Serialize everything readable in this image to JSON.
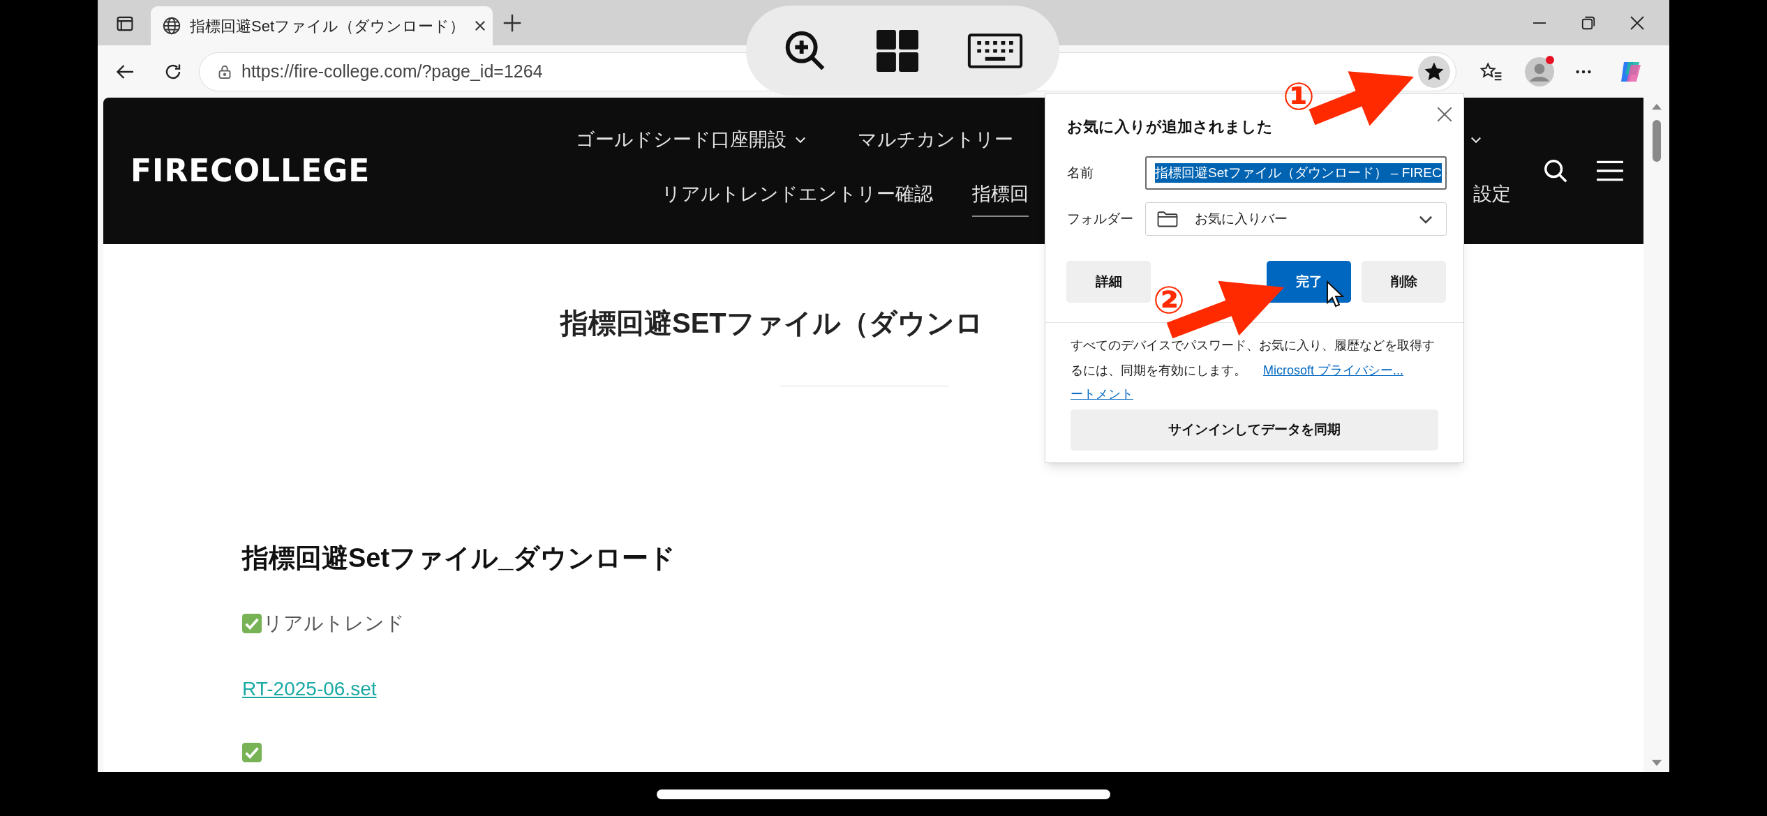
{
  "browser": {
    "tab": {
      "title": "指標回避Setファイル（ダウンロード）",
      "selected": true
    },
    "address": "https://fire-college.com/?page_id=1264",
    "favorite_added": true,
    "profile_notification": true
  },
  "site": {
    "logo": "FIRECOLLEGE",
    "nav_row_1": [
      {
        "label": "ゴールドシード口座開設",
        "dropdown": true
      },
      {
        "label": "マルチカントリー",
        "dropdown": false
      }
    ],
    "nav_row_2": [
      {
        "label": "リアルトレンドエントリー確認",
        "selected": false
      },
      {
        "label": "指標回",
        "selected": true
      }
    ],
    "nav_right": {
      "label": "設定",
      "selected": false
    }
  },
  "page": {
    "title": "指標回避SETファイル（ダウンロ",
    "heading": "指標回避Setファイル_ダウンロード",
    "items": [
      {
        "kind": "checked-label",
        "text": "リアルトレンド"
      },
      {
        "kind": "link",
        "text": "RT-2025-06.set"
      },
      {
        "kind": "checked-cut"
      }
    ]
  },
  "bookmark_popup": {
    "title": "お気に入りが追加されました",
    "name_label": "名前",
    "name_value": "指標回避Setファイル（ダウンロード） – FIREC",
    "name_selected": true,
    "folder_label": "フォルダー",
    "folder_value": "お気に入りバー",
    "buttons": [
      {
        "label": "詳細",
        "primary": false
      },
      {
        "label": "完了",
        "primary": true
      },
      {
        "label": "削除",
        "primary": false
      }
    ],
    "sync_text": "すべてのデバイスでパスワード、お気に入り、履歴などを取得するには、同期を有効にします。",
    "link": "Microsoft プライバシー...",
    "link_continued": "ートメント",
    "sync_button": "サインインしてデータを同期"
  },
  "annotations": [
    {
      "label": "①"
    },
    {
      "label": "②"
    }
  ]
}
